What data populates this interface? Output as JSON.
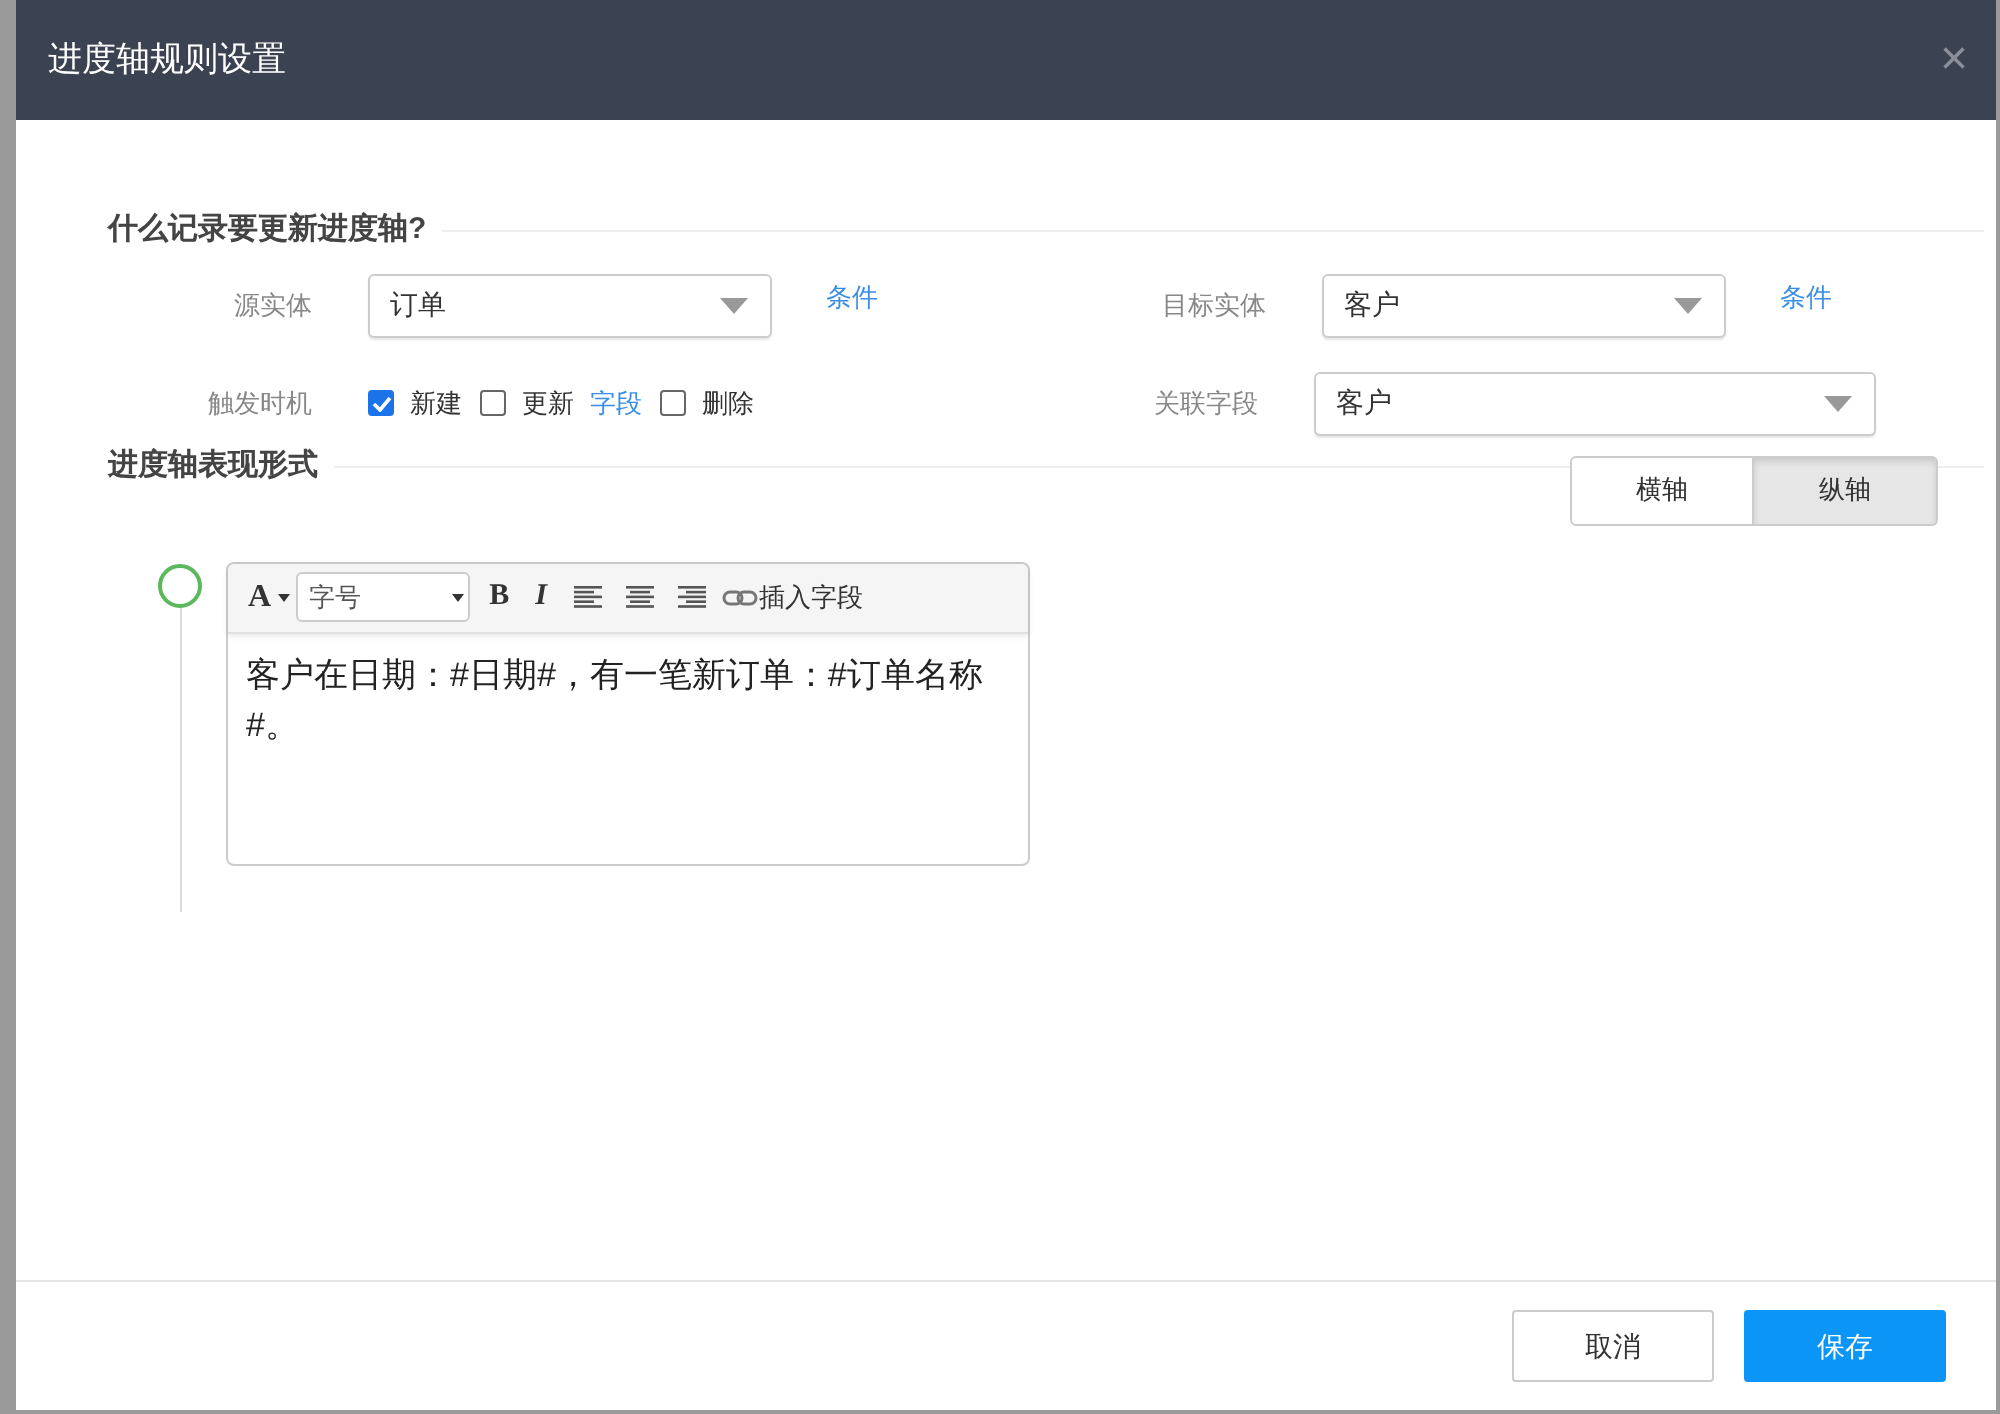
{
  "dialog": {
    "title": "进度轴规则设置",
    "close": "×"
  },
  "section_1": {
    "title": "什么记录要更新进度轴?"
  },
  "source_entity": {
    "label": "源实体",
    "value": "订单",
    "condition_link": "条件"
  },
  "target_entity": {
    "label": "目标实体",
    "value": "客户",
    "condition_link": "条件"
  },
  "trigger": {
    "label": "触发时机",
    "options": [
      {
        "label": "新建",
        "checked": true
      },
      {
        "label": "更新",
        "checked": false,
        "link": "字段"
      },
      {
        "label": "删除",
        "checked": false
      }
    ]
  },
  "related_field": {
    "label": "关联字段",
    "value": "客户"
  },
  "section_2": {
    "title": "进度轴表现形式"
  },
  "orientation_tabs": [
    {
      "label": "横轴",
      "selected": false
    },
    {
      "label": "纵轴",
      "selected": true
    }
  ],
  "editor": {
    "toolbar": {
      "font_color": "A",
      "font_size_placeholder": "字号",
      "bold": "B",
      "italic": "I",
      "insert_field": "插入字段"
    },
    "content": "客户在日期：#日期#，有一笔新订单：#订单名称#。"
  },
  "buttons": [
    {
      "label": "取消",
      "kind": "secondary"
    },
    {
      "label": "保存",
      "kind": "primary"
    }
  ]
}
